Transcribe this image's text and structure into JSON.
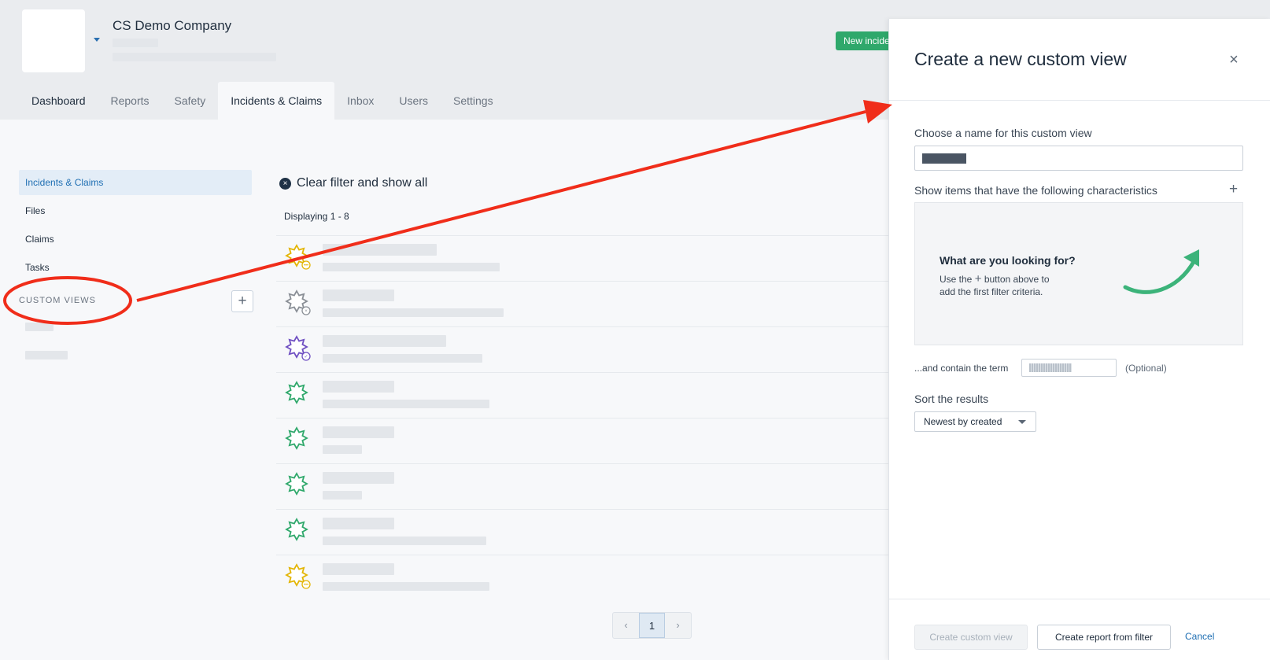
{
  "header": {
    "company_name": "CS Demo Company",
    "new_incident_label": "New incident"
  },
  "nav": {
    "tabs": [
      "Dashboard",
      "Reports",
      "Safety",
      "Incidents & Claims",
      "Inbox",
      "Users",
      "Settings"
    ],
    "active_tab": "Incidents & Claims"
  },
  "sidebar": {
    "items": [
      "Incidents & Claims",
      "Files",
      "Claims",
      "Tasks"
    ],
    "custom_views_label": "CUSTOM VIEWS",
    "custom_views_add": "+"
  },
  "main": {
    "clear_filter": "Clear filter and show all",
    "clear_icon": "×",
    "displaying": "Displaying 1 - 8",
    "rows": [
      {
        "icon": "starburst-icon",
        "color": "#e3b505",
        "badge": "pending"
      },
      {
        "icon": "starburst-icon",
        "color": "#8a8f96",
        "badge": "closed"
      },
      {
        "icon": "starburst-icon",
        "color": "#6f4fc2",
        "badge": "resolved"
      },
      {
        "icon": "starburst-icon",
        "color": "#2fa86b",
        "badge": "none"
      },
      {
        "icon": "starburst-icon",
        "color": "#2fa86b",
        "badge": "none"
      },
      {
        "icon": "starburst-icon",
        "color": "#2fa86b",
        "badge": "none"
      },
      {
        "icon": "starburst-icon",
        "color": "#2fa86b",
        "badge": "none"
      },
      {
        "icon": "starburst-icon",
        "color": "#e3b505",
        "badge": "pending"
      }
    ],
    "pagination": {
      "prev": "‹",
      "current": "1",
      "next": "›"
    }
  },
  "drawer": {
    "title": "Create a new custom view",
    "close": "×",
    "name_label": "Choose a name for this custom view",
    "characteristics_label": "Show items that have the following characteristics",
    "characteristics_add": "+",
    "empty_title": "What are you looking for?",
    "empty_desc_1": "Use the",
    "empty_desc_plus": "+",
    "empty_desc_2": "button above to",
    "empty_desc_3": "add the first filter criteria.",
    "term_label": "...and contain the term",
    "optional": "(Optional)",
    "sort_label": "Sort the results",
    "sort_value": "Newest by created",
    "create_button": "Create custom view",
    "report_button": "Create report from filter",
    "cancel_button": "Cancel"
  },
  "colors": {
    "accent": "#1f6fb3",
    "success": "#2fa86b",
    "annotation": "#f02d1a"
  }
}
